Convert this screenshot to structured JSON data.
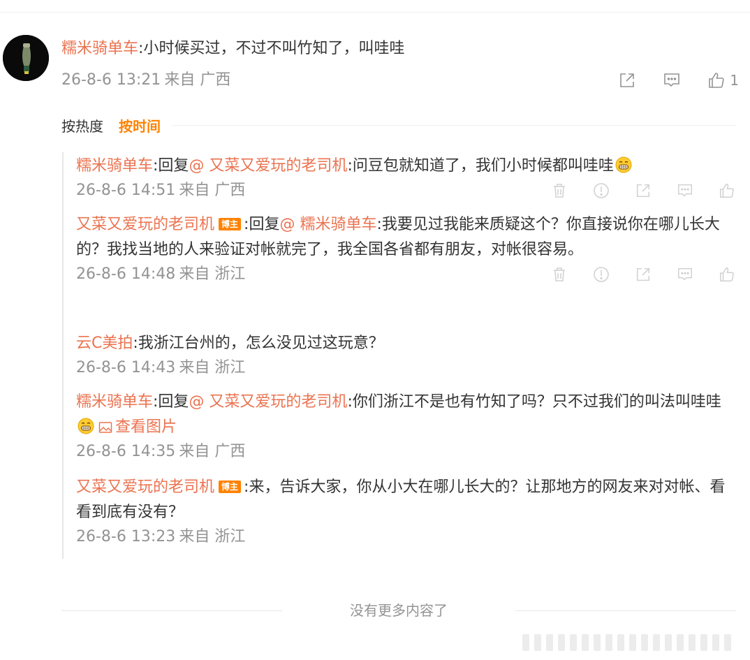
{
  "main_comment": {
    "username": "糯米骑单车",
    "separator": ":",
    "text": "小时候买过，不过不叫竹知了，叫哇哇",
    "timestamp": "26-8-6 13:21",
    "location": "来自 广西",
    "like_count": "1"
  },
  "sort": {
    "by_hot": "按热度",
    "by_time": "按时间"
  },
  "replies": [
    {
      "username": "糯米骑单车",
      "reply_prefix": ":回复",
      "mention": "@ 又菜又爱玩的老司机",
      "text": ":问豆包就知道了，我们小时候都叫哇哇",
      "timestamp": "26-8-6 14:51",
      "location": "来自 广西",
      "has_emoji": true
    },
    {
      "username": "又菜又爱玩的老司机",
      "badge": "博主",
      "reply_prefix": ":回复",
      "mention": "@ 糯米骑单车",
      "text": ":我要见过我能来质疑这个？你直接说你在哪儿长大的？我找当地的人来验证对帐就完了，我全国各省都有朋友，对帐很容易。",
      "timestamp": "26-8-6 14:48",
      "location": "来自 浙江"
    },
    {
      "username": "云C美拍",
      "text": ":我浙江台州的，怎么没见过这玩意？",
      "timestamp": "26-8-6 14:43",
      "location": "来自 浙江"
    },
    {
      "username": "糯米骑单车",
      "reply_prefix": ":回复",
      "mention": "@ 又菜又爱玩的老司机",
      "text": ":你们浙江不是也有竹知了吗？只不过我们的叫法叫哇哇",
      "view_image": "查看图片",
      "timestamp": "26-8-6 14:35",
      "location": "来自 广西",
      "has_emoji": true
    },
    {
      "username": "又菜又爱玩的老司机",
      "badge": "博主",
      "text": ":来，告诉大家，你从小大在哪儿长大的？让那地方的网友来对对帐、看看到底有没有？",
      "timestamp": "26-8-6 13:23",
      "location": "来自 浙江"
    }
  ],
  "footer": {
    "end_text": "没有更多内容了"
  },
  "colors": {
    "username": "#eb7350",
    "meta": "#939393",
    "active_sort": "#ff8200",
    "badge_bg": "#ff8200"
  },
  "icons": {
    "delete": "trash-icon",
    "report": "report-icon",
    "share": "share-icon",
    "reply": "comment-icon",
    "like": "thumbs-up-icon",
    "image": "image-icon",
    "emoji": "grin-emoji-icon"
  }
}
